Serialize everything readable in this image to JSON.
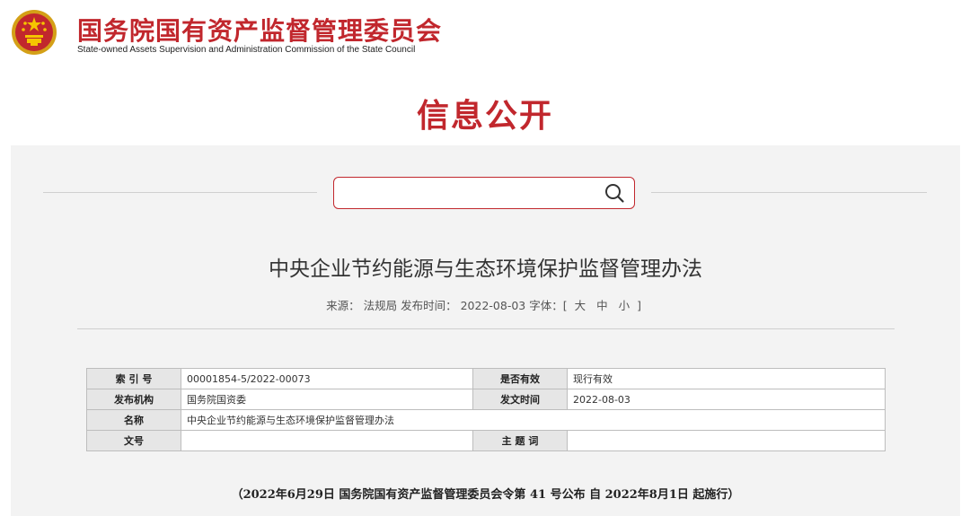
{
  "header": {
    "org_name_cn": "国务院国有资产监督管理委员会",
    "org_name_en": "State-owned Assets Supervision and Administration Commission of the State Council",
    "emblem_icon": "national-emblem-icon"
  },
  "section_title": "信息公开",
  "search": {
    "value": "",
    "placeholder": "",
    "icon": "search-icon"
  },
  "document": {
    "title": "中央企业节约能源与生态环境保护监督管理办法",
    "meta": {
      "source_label": "来源：",
      "source_value": "法规局",
      "publish_label": "发布时间：",
      "publish_value": "2022-08-03",
      "font_label": "字体：[",
      "font_large": "大",
      "font_medium": "中",
      "font_small": "小",
      "font_close": "]"
    }
  },
  "info_table": {
    "index_label": "索 引 号",
    "index_value": "00001854-5/2022-00073",
    "valid_label": "是否有效",
    "valid_value": "现行有效",
    "issuer_label": "发布机构",
    "issuer_value": "国务院国资委",
    "date_label": "发文时间",
    "date_value": "2022-08-03",
    "name_label": "名称",
    "name_value": "中央企业节约能源与生态环境保护监督管理办法",
    "docno_label": "文号",
    "docno_value": "",
    "subject_label": "主 题 词",
    "subject_value": ""
  },
  "notice": "（2022年6月29日 国务院国有资产监督管理委员会令第 41 号公布 自 2022年8月1日 起施行）",
  "colors": {
    "brand_red": "#c1272d",
    "panel_bg": "#f3f3f3",
    "table_label_bg": "#e6e6e6"
  }
}
